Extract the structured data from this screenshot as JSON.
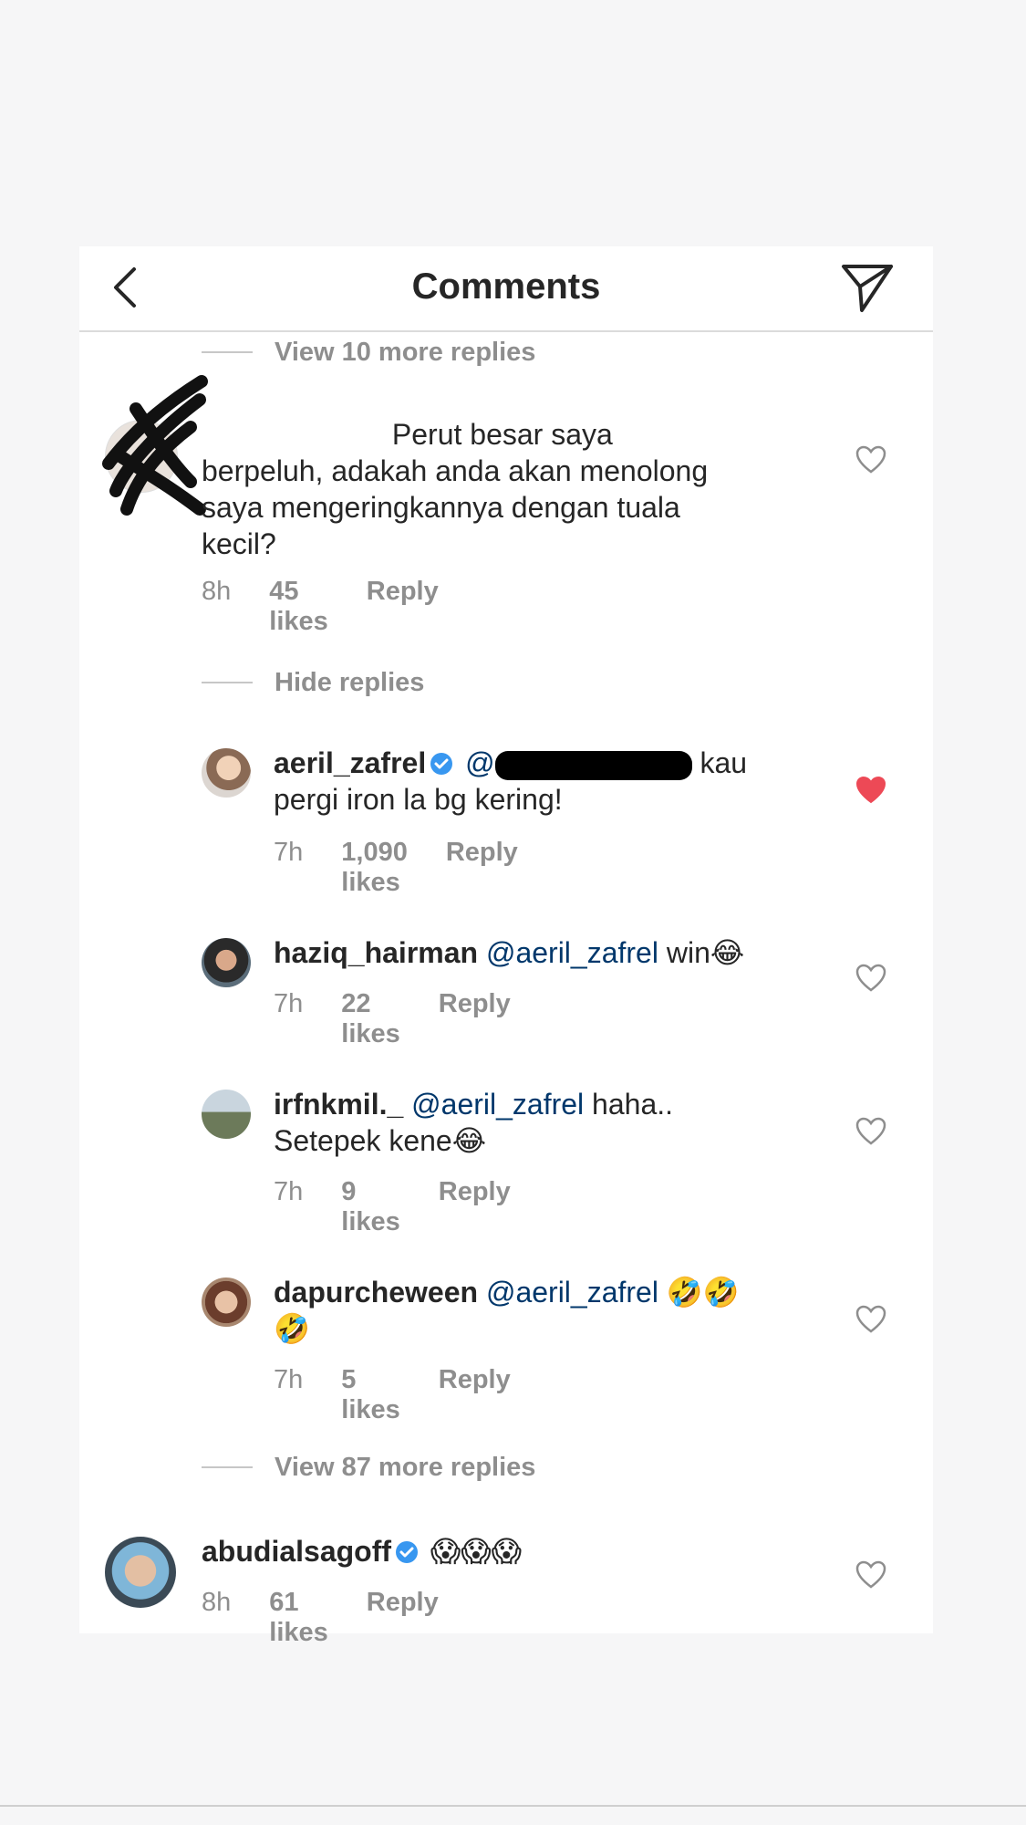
{
  "header": {
    "title": "Comments"
  },
  "toggles": {
    "view_more_top": "View 10 more replies",
    "hide_replies": "Hide replies",
    "view_more_bottom": "View 87 more replies"
  },
  "comments": [
    {
      "username": "",
      "text_part1": "Perut besar saya",
      "text_part2": "berpeluh, adakah anda akan menolong",
      "text_part3": "saya mengeringkannya dengan tuala",
      "text_part4": "kecil?",
      "time": "8h",
      "likes": "45 likes",
      "reply": "Reply",
      "liked": false
    },
    {
      "username": "aeril_zafrel",
      "mention": "@",
      "text_a": "kau",
      "text_b": "pergi iron la bg kering!",
      "time": "7h",
      "likes": "1,090 likes",
      "reply": "Reply",
      "liked": true
    },
    {
      "username": "haziq_hairman",
      "mention": "@aeril_zafrel",
      "text": "win😂",
      "time": "7h",
      "likes": "22 likes",
      "reply": "Reply",
      "liked": false
    },
    {
      "username": "irfnkmil._",
      "mention": "@aeril_zafrel",
      "text_a": "haha..",
      "text_b": "Setepek kene😂",
      "time": "7h",
      "likes": "9 likes",
      "reply": "Reply",
      "liked": false
    },
    {
      "username": "dapurcheween",
      "mention": "@aeril_zafrel",
      "text_a": "🤣🤣",
      "text_b": "🤣",
      "time": "7h",
      "likes": "5 likes",
      "reply": "Reply",
      "liked": false
    },
    {
      "username": "abudialsagoff",
      "text": "😱😱😱",
      "time": "8h",
      "likes": "61 likes",
      "reply": "Reply",
      "liked": false
    }
  ],
  "colors": {
    "liked_heart": "#ed4956",
    "verified_badge": "#3897f0",
    "mention": "#00376b",
    "muted_text": "#8e8e8e"
  }
}
